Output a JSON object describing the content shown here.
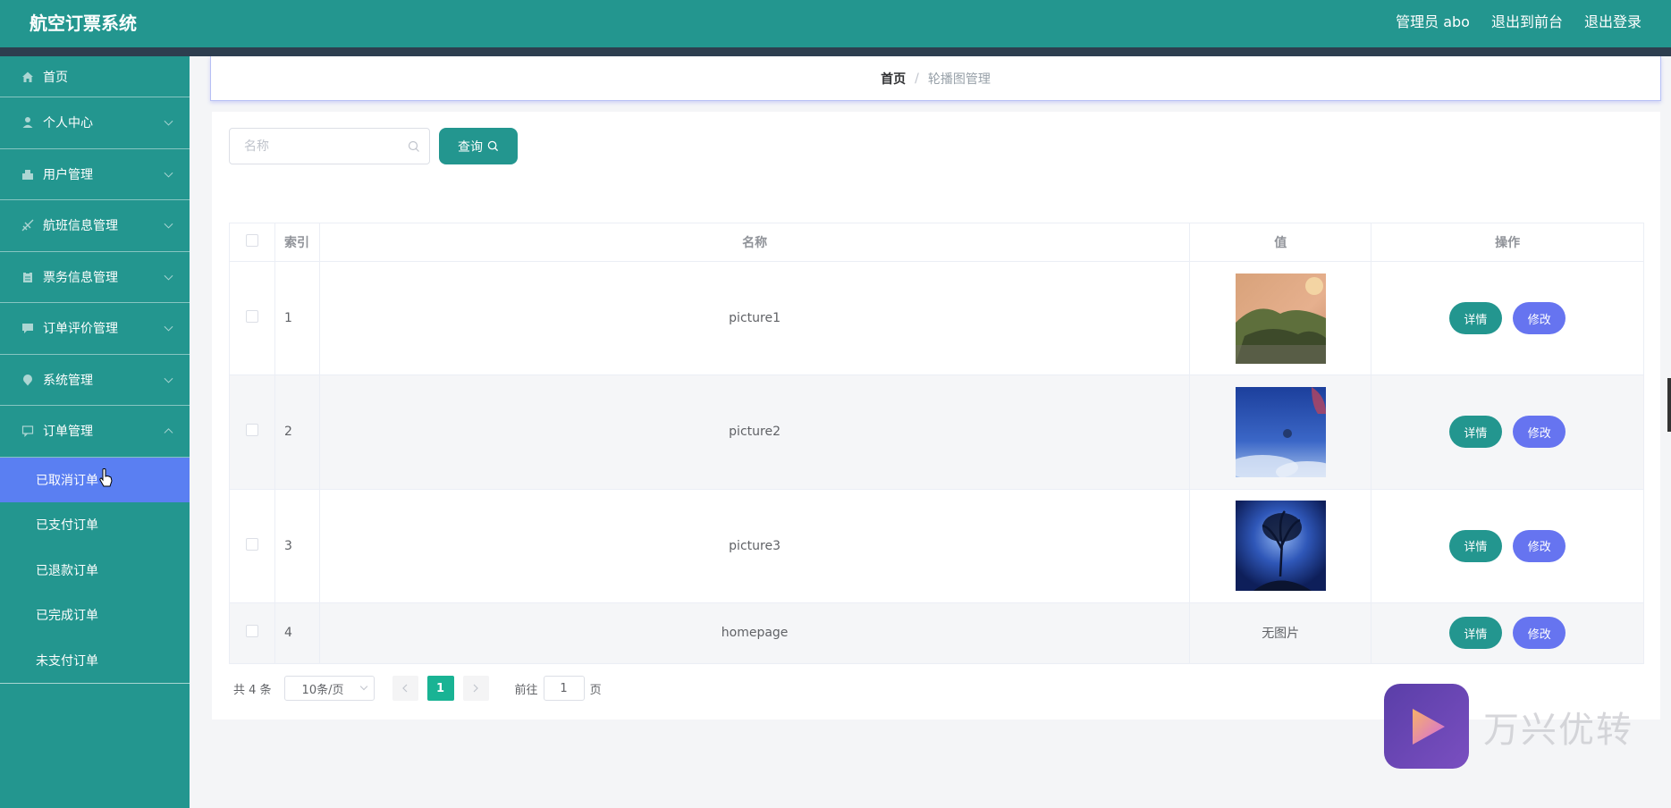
{
  "app": {
    "title": "航空订票系统",
    "header_links": [
      "管理员 abo",
      "退出到前台",
      "退出登录"
    ],
    "accent": "#23968f"
  },
  "sidebar": {
    "items": [
      {
        "label": "首页",
        "icon": "home-icon"
      },
      {
        "label": "个人中心",
        "icon": "user-icon"
      },
      {
        "label": "用户管理",
        "icon": "users-icon"
      },
      {
        "label": "航班信息管理",
        "icon": "plane-icon"
      },
      {
        "label": "票务信息管理",
        "icon": "clipboard-icon"
      },
      {
        "label": "订单评价管理",
        "icon": "comment-icon"
      },
      {
        "label": "系统管理",
        "icon": "location-icon"
      },
      {
        "label": "订单管理",
        "icon": "chat-icon"
      }
    ],
    "sub_items": [
      "已取消订单",
      "已支付订单",
      "已退款订单",
      "已完成订单",
      "未支付订单"
    ],
    "active_sub": "已取消订单",
    "active_color": "#5a7ff2"
  },
  "breadcrumb": {
    "home": "首页",
    "separator": "/",
    "current": "轮播图管理"
  },
  "search": {
    "placeholder": "名称",
    "value": "",
    "button_label": "查询"
  },
  "table": {
    "headers": {
      "index": "索引",
      "name": "名称",
      "value": "值",
      "actions": "操作"
    },
    "rows": [
      {
        "index": "1",
        "name": "picture1",
        "value": "image",
        "image": "landscape-thumbnail"
      },
      {
        "index": "2",
        "name": "picture2",
        "value": "image",
        "image": "blue-sky-thumbnail"
      },
      {
        "index": "3",
        "name": "picture3",
        "value": "image",
        "image": "moon-tree-thumbnail"
      },
      {
        "index": "4",
        "name": "homepage",
        "value": "无图片"
      }
    ],
    "detail_label": "详情",
    "edit_label": "修改"
  },
  "pagination": {
    "total": "共 4 条",
    "page_size": "10条/页",
    "current_page": "1",
    "goto_label": "前往",
    "goto_value": "1",
    "page_suffix": "页"
  },
  "watermark": {
    "text": "万兴优转"
  }
}
